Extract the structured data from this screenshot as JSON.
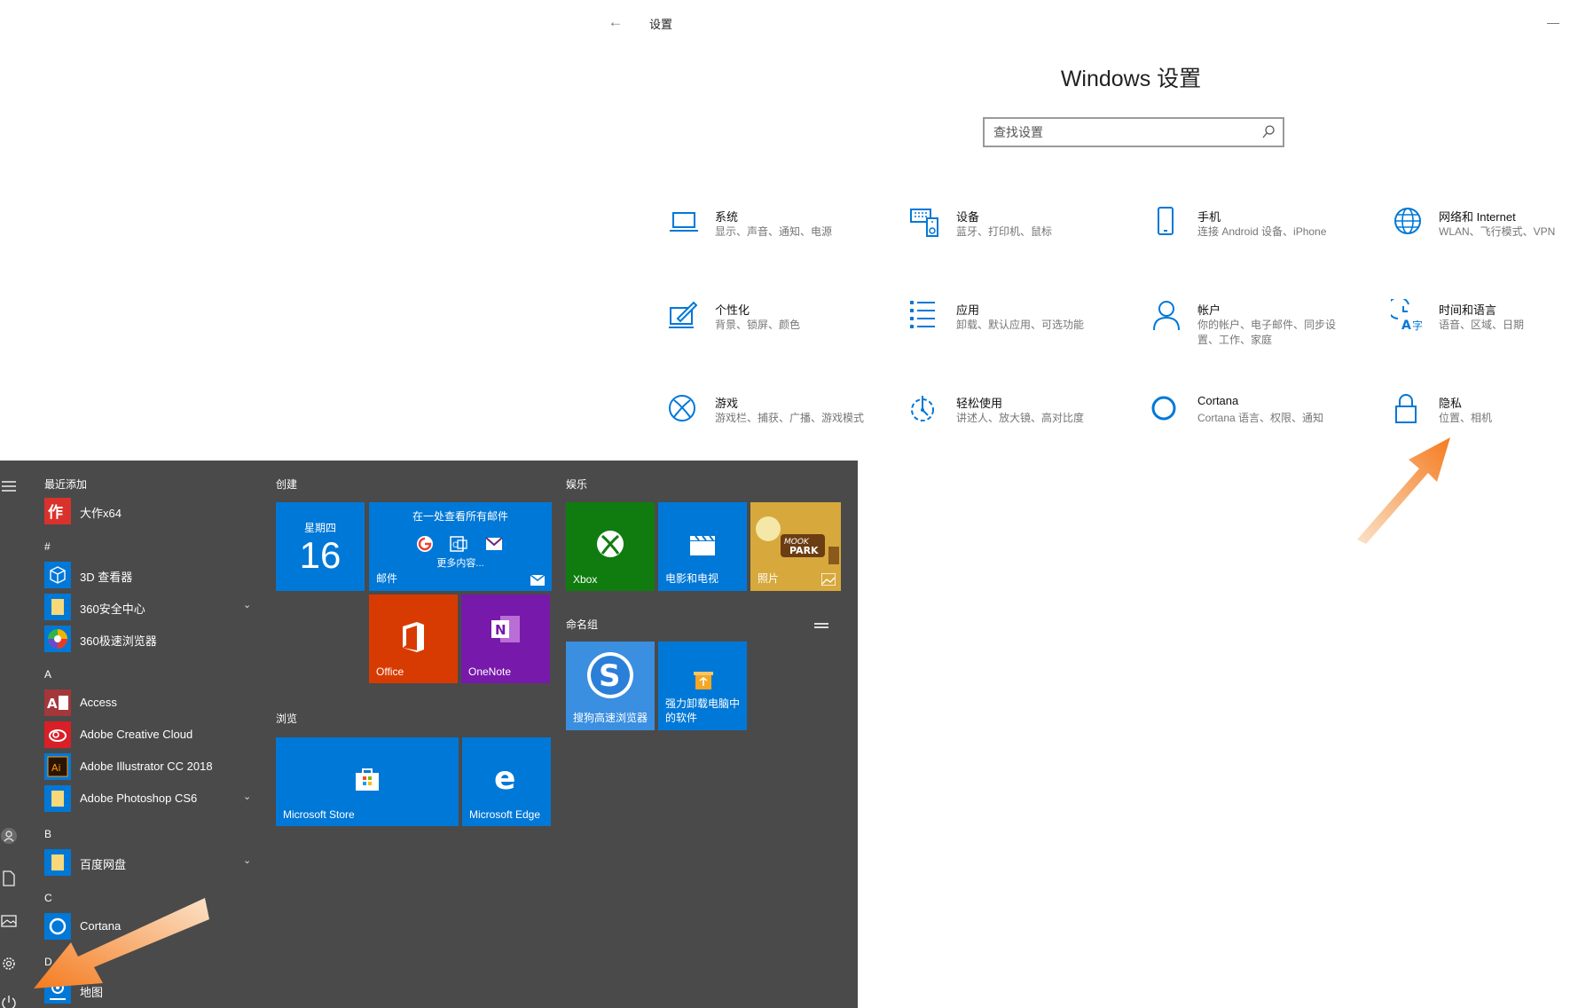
{
  "window": {
    "back_glyph": "←",
    "title": "设置"
  },
  "heading": "Windows 设置",
  "search": {
    "placeholder": "查找设置"
  },
  "categories": [
    {
      "title": "系统",
      "desc": "显示、声音、通知、电源",
      "icon": "laptop-icon"
    },
    {
      "title": "设备",
      "desc": "蓝牙、打印机、鼠标",
      "icon": "keyboard-devices-icon"
    },
    {
      "title": "手机",
      "desc": "连接 Android 设备、iPhone",
      "icon": "phone-icon"
    },
    {
      "title": "网络和 Internet",
      "desc": "WLAN、飞行模式、VPN",
      "icon": "globe-icon"
    },
    {
      "title": "个性化",
      "desc": "背景、锁屏、颜色",
      "icon": "paint-icon"
    },
    {
      "title": "应用",
      "desc": "卸载、默认应用、可选功能",
      "icon": "app-list-icon"
    },
    {
      "title": "帐户",
      "desc": "你的帐户、电子邮件、同步设置、工作、家庭",
      "icon": "person-icon"
    },
    {
      "title": "时间和语言",
      "desc": "语音、区域、日期",
      "icon": "time-language-icon"
    },
    {
      "title": "游戏",
      "desc": "游戏栏、捕获、广播、游戏模式",
      "icon": "xbox-icon"
    },
    {
      "title": "轻松使用",
      "desc": "讲述人、放大镜、高对比度",
      "icon": "ease-of-access-icon"
    },
    {
      "title": "Cortana",
      "desc": "Cortana 语言、权限、通知",
      "icon": "cortana-ring-icon"
    },
    {
      "title": "隐私",
      "desc": "位置、相机",
      "icon": "lock-icon"
    }
  ],
  "start_menu": {
    "recently_added_label": "最近添加",
    "apps": [
      {
        "label": "大作x64",
        "icon": "dazuo-app-icon"
      },
      {
        "label": "#",
        "section": true
      },
      {
        "label": "3D 查看器",
        "icon": "3d-viewer-icon"
      },
      {
        "label": "360安全中心",
        "icon": "folder-icon",
        "expandable": true
      },
      {
        "label": "360极速浏览器",
        "icon": "360-browser-icon"
      },
      {
        "label": "A",
        "section": true
      },
      {
        "label": "Access",
        "icon": "access-app-icon"
      },
      {
        "label": "Adobe Creative Cloud",
        "icon": "creative-cloud-icon"
      },
      {
        "label": "Adobe Illustrator CC 2018",
        "icon": "illustrator-icon"
      },
      {
        "label": "Adobe Photoshop CS6",
        "icon": "folder-icon",
        "expandable": true
      },
      {
        "label": "B",
        "section": true
      },
      {
        "label": "百度网盘",
        "icon": "folder-icon",
        "expandable": true
      },
      {
        "label": "C",
        "section": true
      },
      {
        "label": "Cortana",
        "icon": "cortana-app-icon"
      },
      {
        "label": "D",
        "section": true
      },
      {
        "label": "地图",
        "icon": "maps-icon"
      }
    ],
    "groups": {
      "create": "创建",
      "play": "娱乐",
      "named": "命名组",
      "browse": "浏览"
    },
    "tiles": {
      "calendar": {
        "day_name": "星期四",
        "day_number": "16"
      },
      "mail": {
        "header": "在一处查看所有邮件",
        "more": "更多内容...",
        "label": "邮件"
      },
      "office": "Office",
      "onenote": "OneNote",
      "xbox": "Xbox",
      "movies": "电影和电视",
      "photos": "照片",
      "sogou": "搜狗高速浏览器",
      "uninstall": "强力卸载电脑中\n的软件",
      "store": "Microsoft Store",
      "edge": "Microsoft Edge"
    }
  },
  "colors": {
    "accent": "#0078d7",
    "tile_blue": "#0078d7",
    "office_red": "#d83b01",
    "onenote_purple": "#7719aa",
    "xbox_green": "#107c10",
    "start_bg": "#4a4a4a",
    "arrow_orange": "#f57b1f"
  }
}
